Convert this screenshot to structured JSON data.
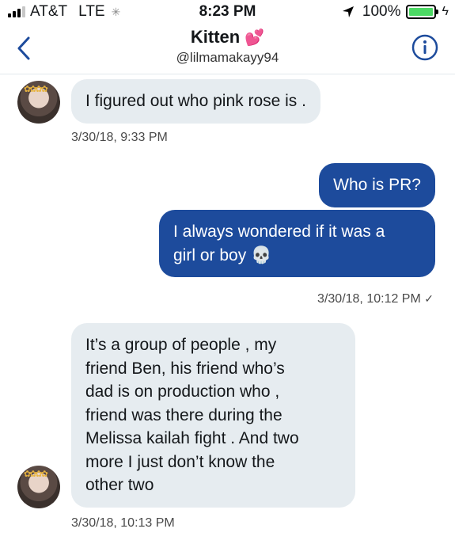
{
  "status_bar": {
    "carrier": "AT&T",
    "network": "LTE",
    "time": "8:23 PM",
    "battery_text": "100%",
    "battery_level": 1.0,
    "battery_color": "#4cd964"
  },
  "header": {
    "title": "Kitten",
    "title_emoji": "💕",
    "handle": "@lilmamakayy94",
    "back_icon": "chevron-left-icon",
    "info_icon": "info-circle-icon",
    "accent_color": "#1d4b9c"
  },
  "messages": [
    {
      "direction": "incoming",
      "text": "I figured out who pink rose is .",
      "timestamp": "3/30/18, 9:33 PM"
    },
    {
      "direction": "outgoing",
      "text": "Who is PR?"
    },
    {
      "direction": "outgoing",
      "text_line1": "I always wondered if it was a",
      "text_line2": "girl or boy",
      "emoji": "💀",
      "timestamp": "3/30/18, 10:12 PM",
      "status": "✓"
    },
    {
      "direction": "incoming",
      "lines": [
        "It’s a group of people , my",
        "friend Ben, his friend who’s",
        "dad is on production who ,",
        "friend was there during the",
        "Melissa kailah fight . And two",
        "more I just don’t know the",
        "other two"
      ],
      "timestamp": "3/30/18, 10:13 PM"
    }
  ]
}
